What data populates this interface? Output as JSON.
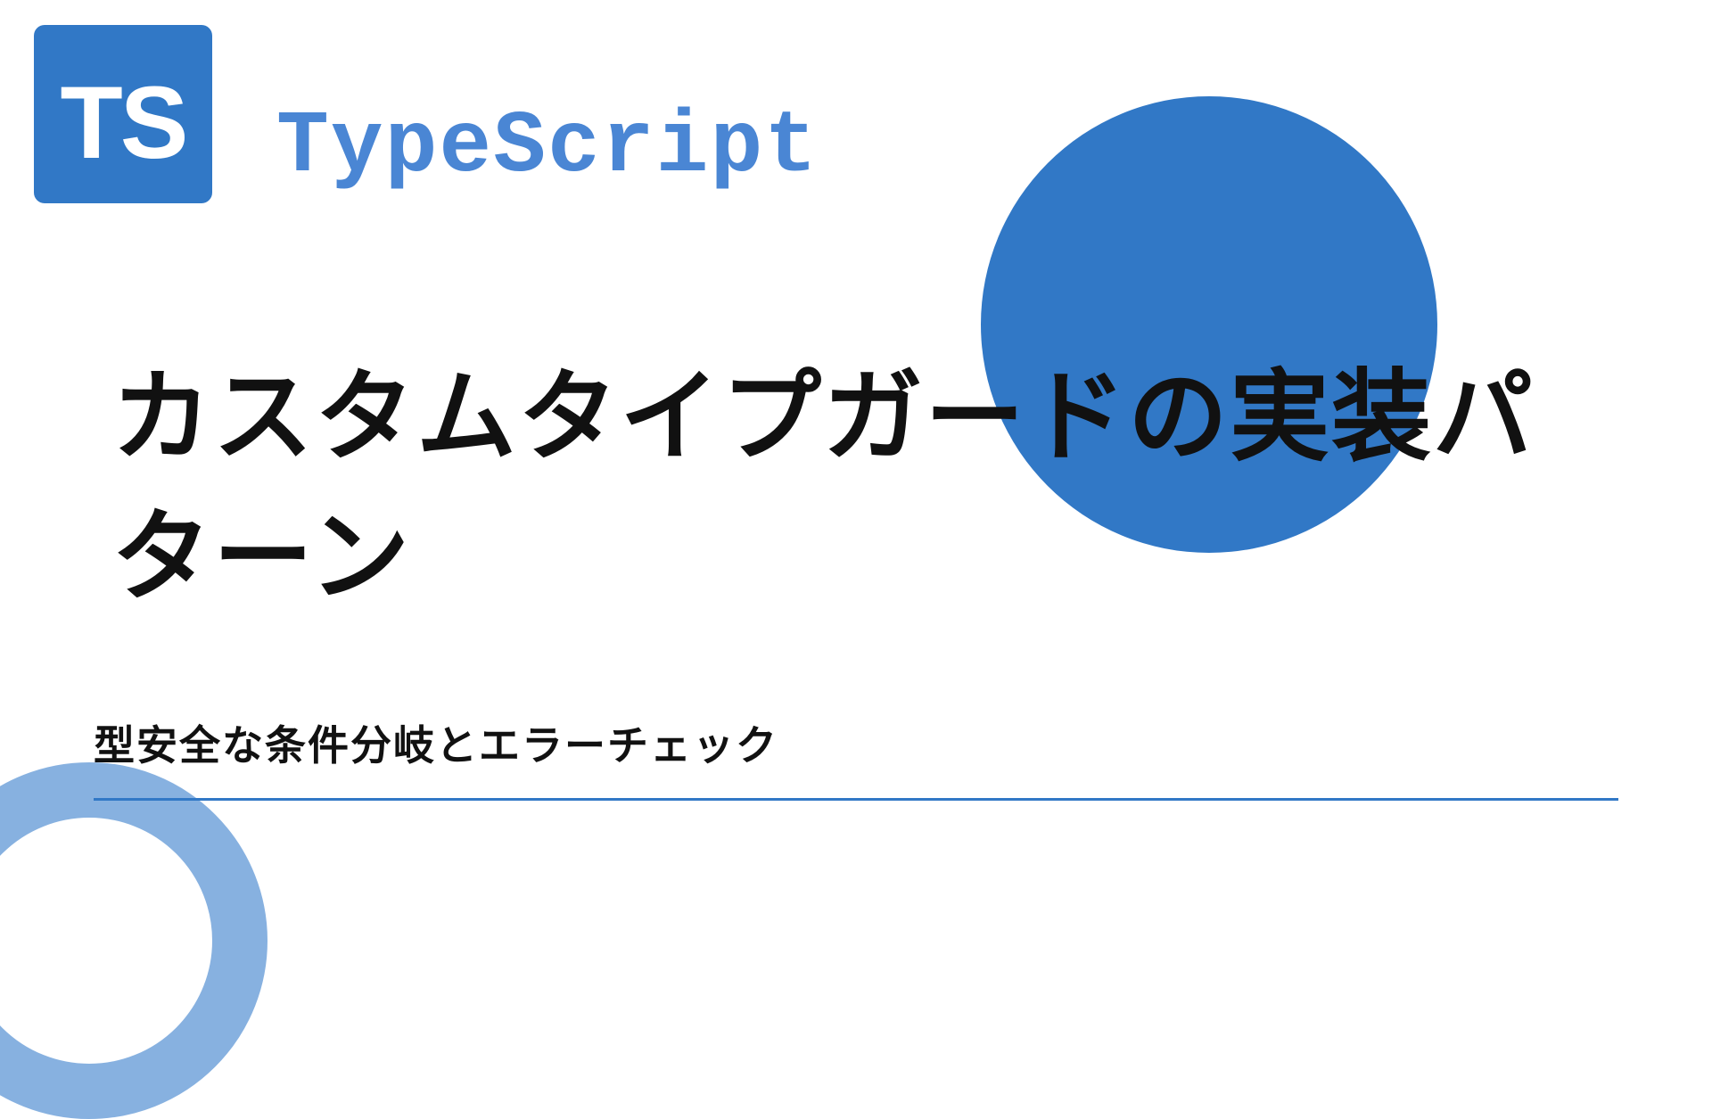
{
  "logo": {
    "text": "TS"
  },
  "brand": {
    "title": "TypeScript"
  },
  "main_title": "カスタムタイプガードの実装パターン",
  "subtitle": "型安全な条件分岐とエラーチェック",
  "colors": {
    "primary": "#3178c6",
    "secondary": "#87b1e0",
    "accent": "#4a86d4"
  }
}
